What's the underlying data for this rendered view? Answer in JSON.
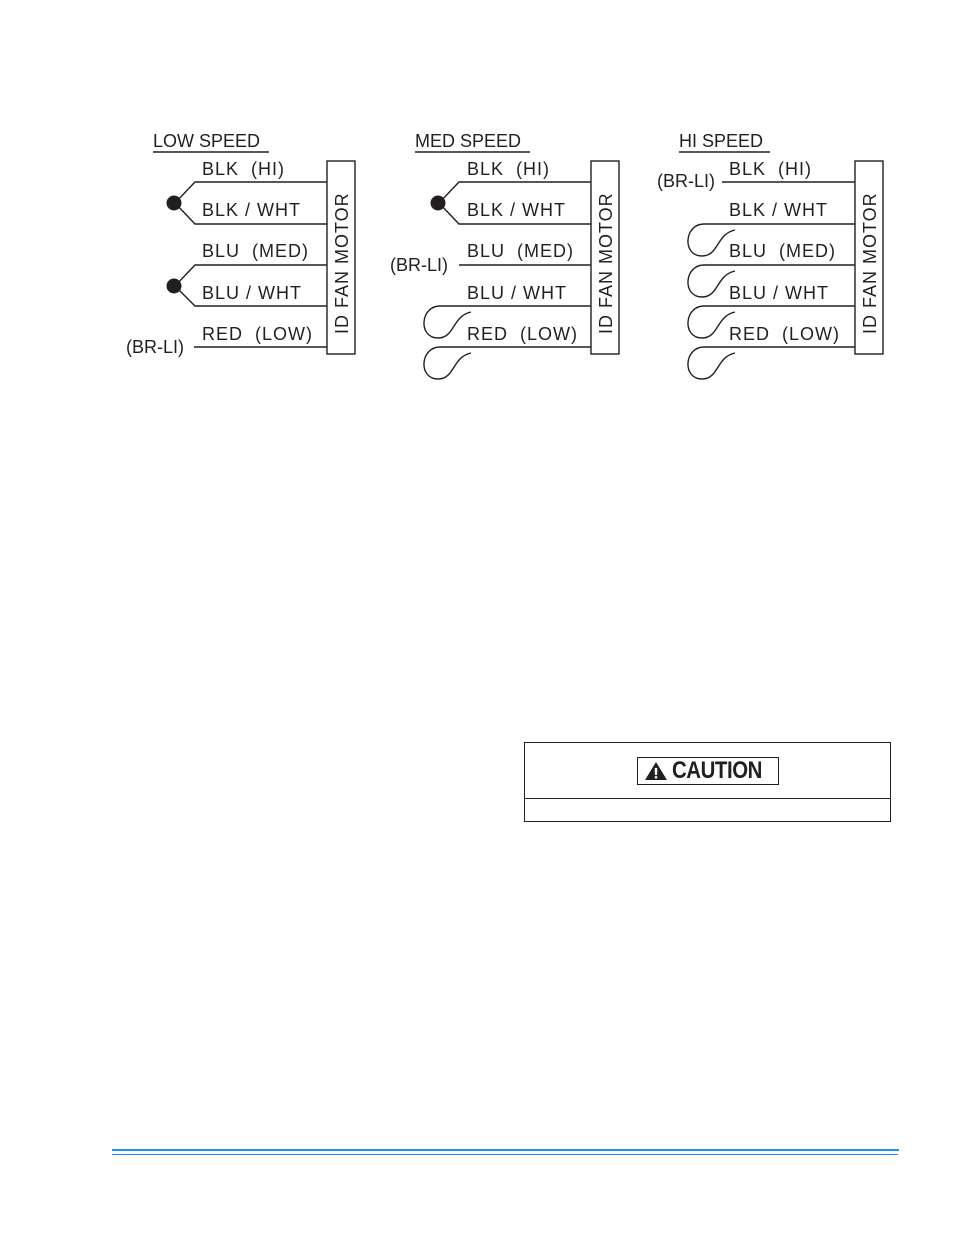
{
  "diagrams": {
    "low": {
      "title": "LOW SPEED",
      "motor_label": "ID FAN MOTOR",
      "wires": [
        "BLK  (HI)",
        "BLK / WHT",
        "BLU  (MED)",
        "BLU / WHT",
        "RED  (LOW)"
      ],
      "connection_label": "(BR-LI)"
    },
    "med": {
      "title": "MED SPEED",
      "motor_label": "ID FAN MOTOR",
      "wires": [
        "BLK  (HI)",
        "BLK / WHT",
        "BLU  (MED)",
        "BLU / WHT",
        "RED  (LOW)"
      ],
      "connection_label": "(BR-LI)"
    },
    "hi": {
      "title": "HI SPEED",
      "motor_label": "ID FAN MOTOR",
      "wires": [
        "BLK  (HI)",
        "BLK / WHT",
        "BLU  (MED)",
        "BLU / WHT",
        "RED  (LOW)"
      ],
      "connection_label": "(BR-LI)"
    }
  },
  "caution": {
    "label": "CAUTION",
    "icon": "warning-triangle-icon",
    "body": ""
  },
  "colors": {
    "ink": "#231f20",
    "footer_rule": "#1e90f0"
  }
}
